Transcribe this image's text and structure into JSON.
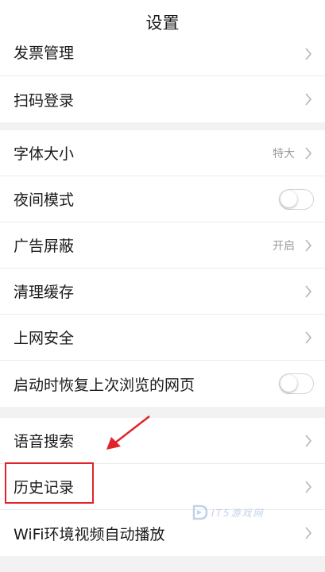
{
  "header": {
    "title": "设置"
  },
  "section1": {
    "items": [
      {
        "label": "发票管理"
      },
      {
        "label": "扫码登录"
      }
    ]
  },
  "section2": {
    "items": [
      {
        "label": "字体大小",
        "value": "特大"
      },
      {
        "label": "夜间模式",
        "toggle": "off"
      },
      {
        "label": "广告屏蔽",
        "value": "开启"
      },
      {
        "label": "清理缓存"
      },
      {
        "label": "上网安全"
      },
      {
        "label": "启动时恢复上次浏览的网页",
        "toggle": "off"
      }
    ]
  },
  "section3": {
    "items": [
      {
        "label": "语音搜索"
      },
      {
        "label": "历史记录"
      },
      {
        "label": "WiFi环境视频自动播放"
      }
    ]
  },
  "watermark": {
    "text": "IT5游戏网"
  },
  "colors": {
    "highlight": "#e0242c",
    "chevron": "#b5b5b5"
  },
  "icons": {
    "chevron": "chevron-right-icon",
    "arrow": "annotation-arrow-icon"
  }
}
